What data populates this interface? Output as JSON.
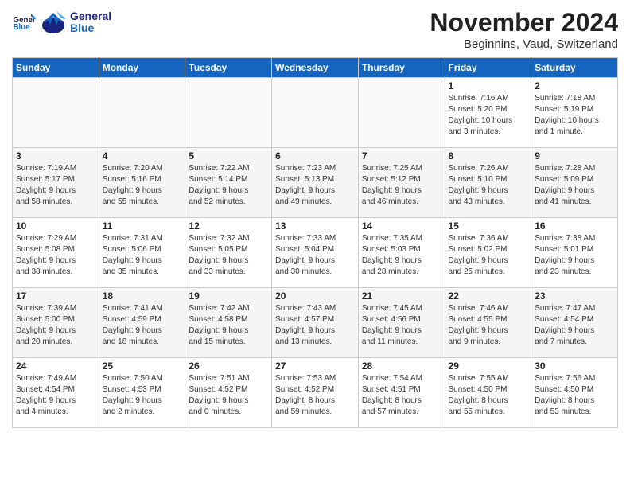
{
  "logo": {
    "text_general": "General",
    "text_blue": "Blue"
  },
  "header": {
    "month": "November 2024",
    "location": "Beginnins, Vaud, Switzerland"
  },
  "days_of_week": [
    "Sunday",
    "Monday",
    "Tuesday",
    "Wednesday",
    "Thursday",
    "Friday",
    "Saturday"
  ],
  "weeks": [
    [
      {
        "day": "",
        "detail": ""
      },
      {
        "day": "",
        "detail": ""
      },
      {
        "day": "",
        "detail": ""
      },
      {
        "day": "",
        "detail": ""
      },
      {
        "day": "",
        "detail": ""
      },
      {
        "day": "1",
        "detail": "Sunrise: 7:16 AM\nSunset: 5:20 PM\nDaylight: 10 hours\nand 3 minutes."
      },
      {
        "day": "2",
        "detail": "Sunrise: 7:18 AM\nSunset: 5:19 PM\nDaylight: 10 hours\nand 1 minute."
      }
    ],
    [
      {
        "day": "3",
        "detail": "Sunrise: 7:19 AM\nSunset: 5:17 PM\nDaylight: 9 hours\nand 58 minutes."
      },
      {
        "day": "4",
        "detail": "Sunrise: 7:20 AM\nSunset: 5:16 PM\nDaylight: 9 hours\nand 55 minutes."
      },
      {
        "day": "5",
        "detail": "Sunrise: 7:22 AM\nSunset: 5:14 PM\nDaylight: 9 hours\nand 52 minutes."
      },
      {
        "day": "6",
        "detail": "Sunrise: 7:23 AM\nSunset: 5:13 PM\nDaylight: 9 hours\nand 49 minutes."
      },
      {
        "day": "7",
        "detail": "Sunrise: 7:25 AM\nSunset: 5:12 PM\nDaylight: 9 hours\nand 46 minutes."
      },
      {
        "day": "8",
        "detail": "Sunrise: 7:26 AM\nSunset: 5:10 PM\nDaylight: 9 hours\nand 43 minutes."
      },
      {
        "day": "9",
        "detail": "Sunrise: 7:28 AM\nSunset: 5:09 PM\nDaylight: 9 hours\nand 41 minutes."
      }
    ],
    [
      {
        "day": "10",
        "detail": "Sunrise: 7:29 AM\nSunset: 5:08 PM\nDaylight: 9 hours\nand 38 minutes."
      },
      {
        "day": "11",
        "detail": "Sunrise: 7:31 AM\nSunset: 5:06 PM\nDaylight: 9 hours\nand 35 minutes."
      },
      {
        "day": "12",
        "detail": "Sunrise: 7:32 AM\nSunset: 5:05 PM\nDaylight: 9 hours\nand 33 minutes."
      },
      {
        "day": "13",
        "detail": "Sunrise: 7:33 AM\nSunset: 5:04 PM\nDaylight: 9 hours\nand 30 minutes."
      },
      {
        "day": "14",
        "detail": "Sunrise: 7:35 AM\nSunset: 5:03 PM\nDaylight: 9 hours\nand 28 minutes."
      },
      {
        "day": "15",
        "detail": "Sunrise: 7:36 AM\nSunset: 5:02 PM\nDaylight: 9 hours\nand 25 minutes."
      },
      {
        "day": "16",
        "detail": "Sunrise: 7:38 AM\nSunset: 5:01 PM\nDaylight: 9 hours\nand 23 minutes."
      }
    ],
    [
      {
        "day": "17",
        "detail": "Sunrise: 7:39 AM\nSunset: 5:00 PM\nDaylight: 9 hours\nand 20 minutes."
      },
      {
        "day": "18",
        "detail": "Sunrise: 7:41 AM\nSunset: 4:59 PM\nDaylight: 9 hours\nand 18 minutes."
      },
      {
        "day": "19",
        "detail": "Sunrise: 7:42 AM\nSunset: 4:58 PM\nDaylight: 9 hours\nand 15 minutes."
      },
      {
        "day": "20",
        "detail": "Sunrise: 7:43 AM\nSunset: 4:57 PM\nDaylight: 9 hours\nand 13 minutes."
      },
      {
        "day": "21",
        "detail": "Sunrise: 7:45 AM\nSunset: 4:56 PM\nDaylight: 9 hours\nand 11 minutes."
      },
      {
        "day": "22",
        "detail": "Sunrise: 7:46 AM\nSunset: 4:55 PM\nDaylight: 9 hours\nand 9 minutes."
      },
      {
        "day": "23",
        "detail": "Sunrise: 7:47 AM\nSunset: 4:54 PM\nDaylight: 9 hours\nand 7 minutes."
      }
    ],
    [
      {
        "day": "24",
        "detail": "Sunrise: 7:49 AM\nSunset: 4:54 PM\nDaylight: 9 hours\nand 4 minutes."
      },
      {
        "day": "25",
        "detail": "Sunrise: 7:50 AM\nSunset: 4:53 PM\nDaylight: 9 hours\nand 2 minutes."
      },
      {
        "day": "26",
        "detail": "Sunrise: 7:51 AM\nSunset: 4:52 PM\nDaylight: 9 hours\nand 0 minutes."
      },
      {
        "day": "27",
        "detail": "Sunrise: 7:53 AM\nSunset: 4:52 PM\nDaylight: 8 hours\nand 59 minutes."
      },
      {
        "day": "28",
        "detail": "Sunrise: 7:54 AM\nSunset: 4:51 PM\nDaylight: 8 hours\nand 57 minutes."
      },
      {
        "day": "29",
        "detail": "Sunrise: 7:55 AM\nSunset: 4:50 PM\nDaylight: 8 hours\nand 55 minutes."
      },
      {
        "day": "30",
        "detail": "Sunrise: 7:56 AM\nSunset: 4:50 PM\nDaylight: 8 hours\nand 53 minutes."
      }
    ]
  ]
}
